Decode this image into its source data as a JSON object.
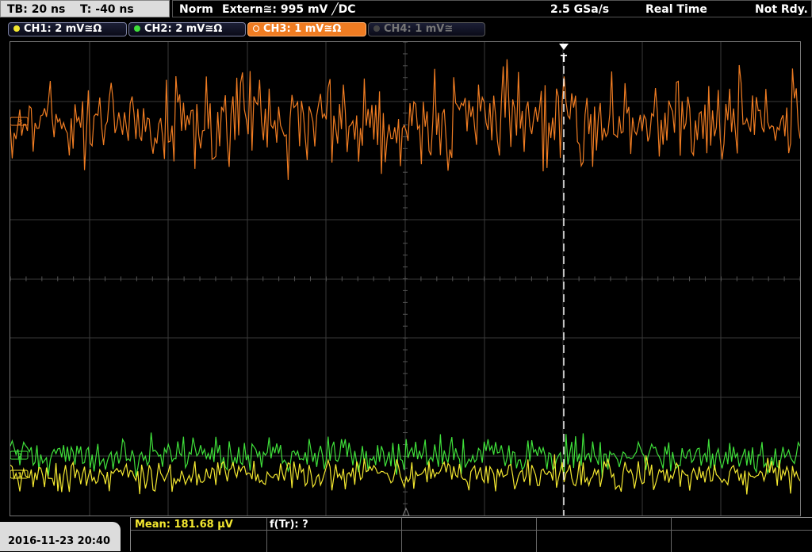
{
  "timebase": {
    "tb_label": "TB: 20 ns",
    "trigger_offset": "T: -40 ns"
  },
  "status": {
    "mode": "Norm",
    "trigger_source": "Extern≅: 995 mV ╱DC",
    "sample_rate": "2.5 GSa/s",
    "acquisition": "Real Time",
    "state": "Not Rdy."
  },
  "channels": [
    {
      "label": "CH1: 2 mV≅Ω",
      "color": "#f4e830",
      "state": "on"
    },
    {
      "label": "CH2: 2 mV≅Ω",
      "color": "#3fe03a",
      "state": "on"
    },
    {
      "label": "CH3: 1 mV≅Ω",
      "color": "#ef7c22",
      "state": "active"
    },
    {
      "label": "CH4: 1 mV≅",
      "color": "#555555",
      "state": "off"
    }
  ],
  "markers": {
    "ch3": "3",
    "ch2": "2",
    "ch1": "1",
    "trigger": "T"
  },
  "measurement": {
    "mean": "Mean: 181.68 µV",
    "f_tr": "f(Tr): ?"
  },
  "datetime": "2016-11-23 20:40",
  "colors": {
    "ch1": "#f4e830",
    "ch2": "#3fe03a",
    "ch3": "#ef7c22",
    "grid": "#3a3a3a"
  }
}
